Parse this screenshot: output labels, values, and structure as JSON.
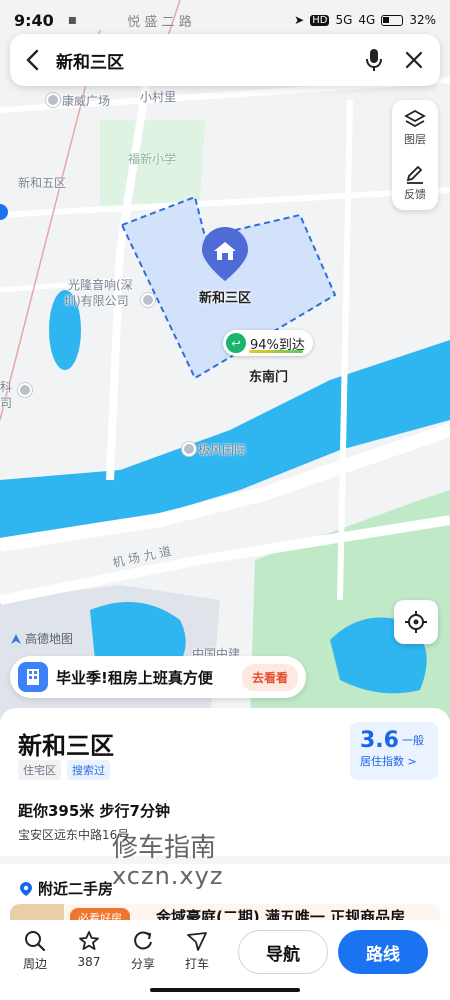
{
  "status": {
    "time": "9:40",
    "signal_5g": "5G",
    "signal_4g": "4G",
    "battery": "32%",
    "road_top": "悦 盛 二 路",
    "corner_text": "村"
  },
  "search": {
    "query": "新和三区"
  },
  "tools": {
    "layers_label": "图层",
    "feedback_label": "反馈"
  },
  "map": {
    "labels": {
      "kangwei": "康威广场",
      "xiaocun": "小村里",
      "fuxin_school": "福新小学",
      "xinhe5": "新和五区",
      "guanglong": "光隆音响(深",
      "guanglong2": "圳)有限公司",
      "ke": "科",
      "si": "司",
      "jifeng": "极风国际",
      "airport_road": "机 场 九 道",
      "zhongguo": "中国中建"
    },
    "pin_label": "新和三区",
    "gate_percent": "94%到达",
    "gate_name": "东南门",
    "logo": "高德地图",
    "colors": {
      "river": "#2fb6f0",
      "grass": "#bfe9c7",
      "area_fill": "#c7dcfb",
      "area_stroke": "#2d6fd6"
    }
  },
  "promo": {
    "text": "毕业季!租房上班真方便",
    "button": "去看看"
  },
  "place": {
    "name": "新和三区",
    "tags": [
      "住宅区",
      "搜索过"
    ],
    "score": "3.6",
    "score_level": "一般",
    "score_label": "居住指数 >",
    "distance": "距你395米  步行7分钟",
    "address": "宝安区远东中路16号",
    "nearby_title": "附近二手房",
    "listing_badge": "必看好房",
    "listing_text": "金域豪庭(二期) 满五唯一 正规商品房"
  },
  "watermark": {
    "line1": "修车指南",
    "line2": "xczn.xyz"
  },
  "bottom_nav": {
    "items": [
      {
        "label": "周边",
        "icon": "search-icon"
      },
      {
        "label": "387",
        "icon": "star-icon"
      },
      {
        "label": "分享",
        "icon": "share-icon"
      },
      {
        "label": "打车",
        "icon": "taxi-icon"
      }
    ],
    "navigate": "导航",
    "route": "路线"
  }
}
